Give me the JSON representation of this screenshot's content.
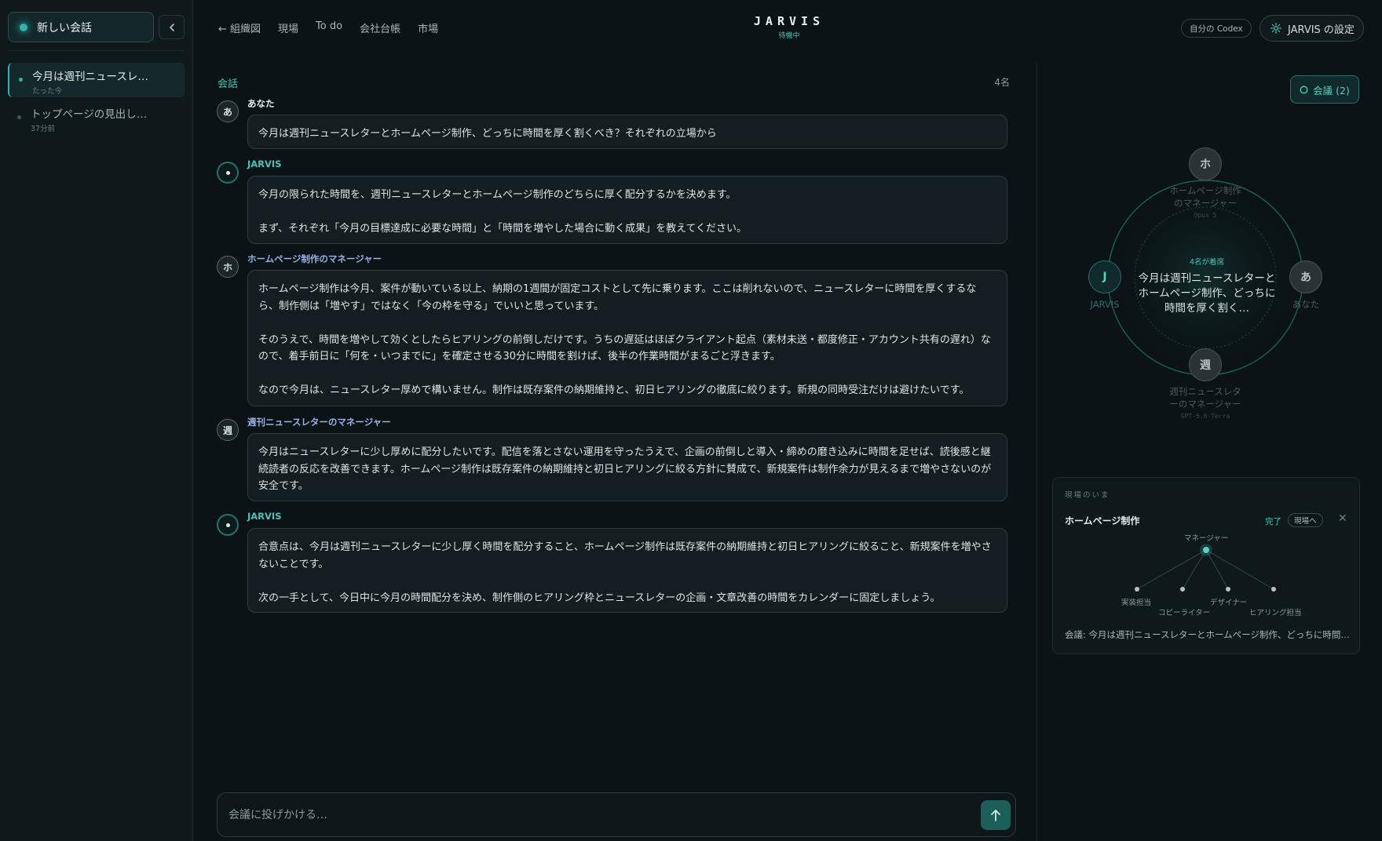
{
  "sidebar": {
    "new_chat_label": "新しい会話",
    "conversations": [
      {
        "title": "今月は週刊ニュースレ…",
        "time": "たった今"
      },
      {
        "title": "トップページの見出し…",
        "time": "37分前"
      }
    ]
  },
  "nav": {
    "items": [
      "← 組織図",
      "現場",
      "To do",
      "会社台帳",
      "市場"
    ]
  },
  "brand": {
    "title": "JARVIS",
    "status": "待機中"
  },
  "header_right": {
    "codex_label": "自分の Codex",
    "settings_label": "JARVIS の設定"
  },
  "chat": {
    "section_label": "会話",
    "participant_count": "4名",
    "messages": [
      {
        "avatar": "あ",
        "sender": "あなた",
        "paragraphs": [
          "今月は週刊ニュースレターとホームページ制作、どっちに時間を厚く割くべき？それぞれの立場から"
        ]
      },
      {
        "avatar": "",
        "sender": "JARVIS",
        "paragraphs": [
          "今月の限られた時間を、週刊ニュースレターとホームページ制作のどちらに厚く配分するかを決めます。",
          "まず、それぞれ「今月の目標達成に必要な時間」と「時間を増やした場合に動く成果」を教えてください。"
        ]
      },
      {
        "avatar": "ホ",
        "sender": "ホームページ制作のマネージャー",
        "paragraphs": [
          "ホームページ制作は今月、案件が動いている以上、納期の1週間が固定コストとして先に乗ります。ここは削れないので、ニュースレターに時間を厚くするなら、制作側は「増やす」ではなく「今の枠を守る」でいいと思っています。",
          "そのうえで、時間を増やして効くとしたらヒアリングの前倒しだけです。うちの遅延はほぼクライアント起点（素材未送・都度修正・アカウント共有の遅れ）なので、着手前日に「何を・いつまでに」を確定させる30分に時間を割けば、後半の作業時間がまるごと浮きます。",
          "なので今月は、ニュースレター厚めで構いません。制作は既存案件の納期維持と、初日ヒアリングの徹底に絞ります。新規の同時受注だけは避けたいです。"
        ]
      },
      {
        "avatar": "週",
        "sender": "週刊ニュースレターのマネージャー",
        "paragraphs": [
          "今月はニュースレターに少し厚めに配分したいです。配信を落とさない運用を守ったうえで、企画の前倒しと導入・締めの磨き込みに時間を足せば、読後感と継続読者の反応を改善できます。ホームページ制作は既存案件の納期維持と初日ヒアリングに絞る方針に賛成で、新規案件は制作余力が見えるまで増やさないのが安全です。"
        ]
      },
      {
        "avatar": "",
        "sender": "JARVIS",
        "paragraphs": [
          "合意点は、今月は週刊ニュースレターに少し厚く時間を配分すること、ホームページ制作は既存案件の納期維持と初日ヒアリングに絞ること、新規案件を増やさないことです。",
          "次の一手として、今日中に今月の時間配分を決め、制作側のヒアリング枠とニュースレターの企画・文章改善の時間をカレンダーに固定しましょう。"
        ]
      }
    ]
  },
  "composer": {
    "placeholder": "会議に投げかける…"
  },
  "meeting": {
    "pill_label": "会議 (2)",
    "seated_label": "4名が着席",
    "topic": "今月は週刊ニュースレターとホームページ制作、どっちに時間を厚く割く…",
    "nodes": {
      "top": {
        "initial": "ホ",
        "name_line1": "ホームページ制作",
        "name_line2": "のマネージャー",
        "model": "Opus 5"
      },
      "left": {
        "initial": "J",
        "name": "JARVIS"
      },
      "right": {
        "initial": "あ",
        "name": "あなた"
      },
      "bottom": {
        "initial": "週",
        "name_line1": "週刊ニュースレタ",
        "name_line2": "ーのマネージャー",
        "model": "GPT-5.6-Terra"
      }
    }
  },
  "field": {
    "heading": "現場のいま",
    "title": "ホームページ制作",
    "status": "完了",
    "goto_label": "現場へ",
    "roles": {
      "root": "マネージャー",
      "r1": "実装担当",
      "r2": "コピーライター",
      "r3": "デザイナー",
      "r4": "ヒアリング担当"
    },
    "footer": "会議: 今月は週刊ニュースレターとホームページ制作、どっちに時間…"
  },
  "colors": {
    "accent": "#2fb3ad",
    "agent_name": "#9ab0e6",
    "background": "#0b1316"
  },
  "icons": [
    "chevron-left-icon",
    "arrow-left-icon",
    "gear-icon",
    "arrow-up-icon",
    "close-icon",
    "ring-icon"
  ]
}
